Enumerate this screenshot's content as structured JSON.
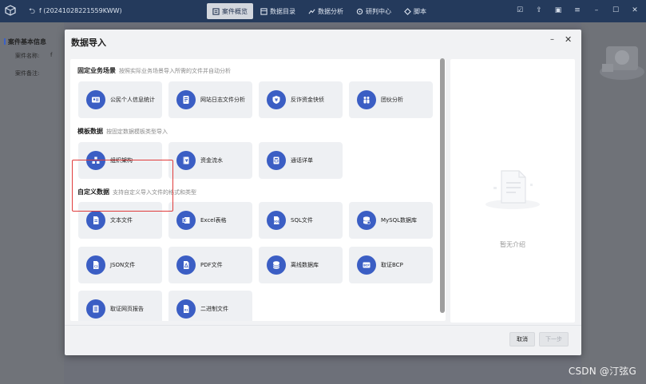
{
  "app": {
    "back_symbol": "⮌",
    "case_title": "f (20241028221559KWW)",
    "nav": [
      {
        "label": "案件概览",
        "active": true
      },
      {
        "label": "数据目录",
        "active": false
      },
      {
        "label": "数据分析",
        "active": false
      },
      {
        "label": "研判中心",
        "active": false
      },
      {
        "label": "脚本",
        "active": false
      }
    ]
  },
  "side": {
    "heading": "案件基本信息",
    "name_label": "案件名称:",
    "name_value": "f",
    "note_label": "案件备注:"
  },
  "dialog": {
    "title": "数据导入",
    "minimize_symbol": "–",
    "close_symbol": "✕",
    "sections": [
      {
        "title": "固定业务场景",
        "desc": "按照实际业务场景导入所需的文件并自动分析",
        "items": [
          {
            "label": "公民个人信息统计",
            "icon": "id-card-icon"
          },
          {
            "label": "网站日志文件分析",
            "icon": "log-file-icon"
          },
          {
            "label": "反诈资金快侦",
            "icon": "shield-money-icon"
          },
          {
            "label": "团伙分析",
            "icon": "group-icon"
          }
        ]
      },
      {
        "title": "模板数据",
        "desc": "按固定数据模板类型导入",
        "items": [
          {
            "label": "组织架构",
            "icon": "org-chart-icon"
          },
          {
            "label": "资金流水",
            "icon": "ledger-icon"
          },
          {
            "label": "通话详单",
            "icon": "call-record-icon"
          }
        ]
      },
      {
        "title": "自定义数据",
        "desc": "支持自定义导入文件的格式和类型",
        "items": [
          {
            "label": "文本文件",
            "icon": "text-file-icon"
          },
          {
            "label": "Excel表格",
            "icon": "excel-icon"
          },
          {
            "label": "SQL文件",
            "icon": "sql-file-icon"
          },
          {
            "label": "MySQL数据库",
            "icon": "mysql-db-icon"
          },
          {
            "label": "JSON文件",
            "icon": "json-file-icon"
          },
          {
            "label": "PDF文件",
            "icon": "pdf-file-icon"
          },
          {
            "label": "离线数据库",
            "icon": "database-icon"
          },
          {
            "label": "取证BCP",
            "icon": "bcp-icon"
          },
          {
            "label": "取证网页报告",
            "icon": "web-report-icon"
          },
          {
            "label": "二进制文件",
            "icon": "binary-file-icon"
          }
        ]
      }
    ],
    "intro_text": "暂无介绍",
    "cancel_label": "取消",
    "next_label": "下一步"
  },
  "watermark": "CSDN @汀弦G",
  "colors": {
    "icon_blue": "#3b5ec4",
    "titlebar": "#243a5c",
    "highlight_red": "#e03b3b"
  }
}
